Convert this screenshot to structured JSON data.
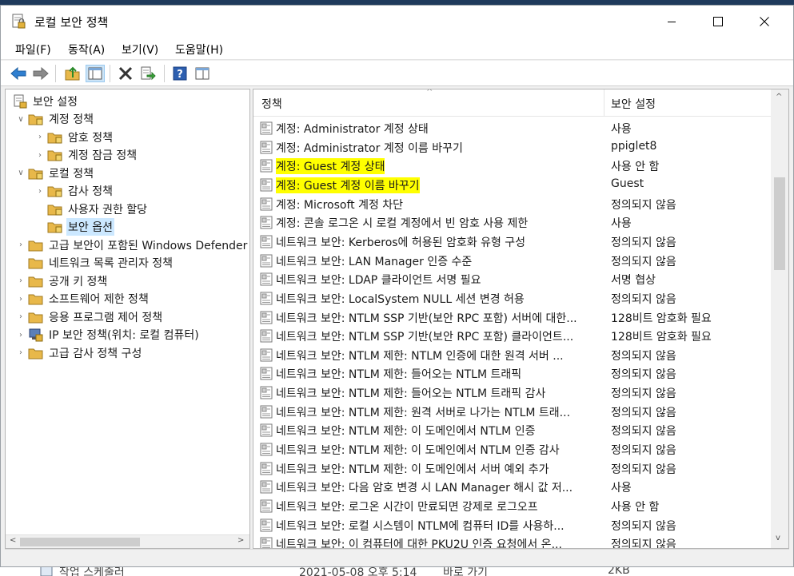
{
  "window": {
    "title": "로컬 보안 정책"
  },
  "menu": [
    "파일(F)",
    "동작(A)",
    "보기(V)",
    "도움말(H)"
  ],
  "toolbar": [
    "back-icon",
    "forward-icon",
    "up-folder-icon",
    "show-hide-tree-icon",
    "delete-icon",
    "export-list-icon",
    "help-icon",
    "properties-icon"
  ],
  "tree": {
    "root": "보안 설정",
    "nodes": [
      {
        "label": "계정 정책",
        "level": 1,
        "expander": "expanded"
      },
      {
        "label": "암호 정책",
        "level": 2,
        "expander": "collapsed"
      },
      {
        "label": "계정 잠금 정책",
        "level": 2,
        "expander": "collapsed"
      },
      {
        "label": "로컬 정책",
        "level": 1,
        "expander": "expanded"
      },
      {
        "label": "감사 정책",
        "level": 2,
        "expander": "collapsed"
      },
      {
        "label": "사용자 권한 할당",
        "level": 2,
        "expander": "none"
      },
      {
        "label": "보안 옵션",
        "level": 2,
        "expander": "none",
        "selected": true
      },
      {
        "label": "고급 보안이 포함된 Windows Defender 방화벽",
        "level": 1,
        "expander": "collapsed"
      },
      {
        "label": "네트워크 목록 관리자 정책",
        "level": 1,
        "expander": "none"
      },
      {
        "label": "공개 키 정책",
        "level": 1,
        "expander": "collapsed"
      },
      {
        "label": "소프트웨어 제한 정책",
        "level": 1,
        "expander": "collapsed"
      },
      {
        "label": "응용 프로그램 제어 정책",
        "level": 1,
        "expander": "collapsed"
      },
      {
        "label": "IP 보안 정책(위치: 로컬 컴퓨터)",
        "level": 1,
        "expander": "collapsed",
        "icon": "ip-security-icon"
      },
      {
        "label": "고급 감사 정책 구성",
        "level": 1,
        "expander": "collapsed"
      }
    ]
  },
  "list": {
    "columns": {
      "policy": "정책",
      "setting": "보안 설정"
    },
    "rows": [
      {
        "policy": "계정: Administrator 계정 상태",
        "setting": "사용"
      },
      {
        "policy": "계정: Administrator 계정 이름 바꾸기",
        "setting": "ppiglet8"
      },
      {
        "policy": "계정: Guest 계정 상태",
        "setting": "사용 안 함",
        "highlighted": true
      },
      {
        "policy": "계정: Guest 계정 이름 바꾸기",
        "setting": "Guest",
        "highlighted": true
      },
      {
        "policy": "계정: Microsoft 계정 차단",
        "setting": "정의되지 않음"
      },
      {
        "policy": "계정: 콘솔 로그온 시 로컬 계정에서 빈 암호 사용 제한",
        "setting": "사용"
      },
      {
        "policy": "네트워크 보안: Kerberos에 허용된 암호화 유형 구성",
        "setting": "정의되지 않음"
      },
      {
        "policy": "네트워크 보안: LAN Manager 인증 수준",
        "setting": "정의되지 않음"
      },
      {
        "policy": "네트워크 보안: LDAP 클라이언트 서명 필요",
        "setting": "서명 협상"
      },
      {
        "policy": "네트워크 보안: LocalSystem NULL 세션 변경 허용",
        "setting": "정의되지 않음"
      },
      {
        "policy": "네트워크 보안: NTLM SSP 기반(보안 RPC 포함) 서버에 대한...",
        "setting": "128비트 암호화 필요"
      },
      {
        "policy": "네트워크 보안: NTLM SSP 기반(보안 RPC 포함) 클라이언트...",
        "setting": "128비트 암호화 필요"
      },
      {
        "policy": "네트워크 보안: NTLM 제한: NTLM 인증에 대한 원격 서버 ...",
        "setting": "정의되지 않음"
      },
      {
        "policy": "네트워크 보안: NTLM 제한: 들어오는 NTLM 트래픽",
        "setting": "정의되지 않음"
      },
      {
        "policy": "네트워크 보안: NTLM 제한: 들어오는 NTLM 트래픽 감사",
        "setting": "정의되지 않음"
      },
      {
        "policy": "네트워크 보안: NTLM 제한: 원격 서버로 나가는 NTLM 트래...",
        "setting": "정의되지 않음"
      },
      {
        "policy": "네트워크 보안: NTLM 제한: 이 도메인에서 NTLM 인증",
        "setting": "정의되지 않음"
      },
      {
        "policy": "네트워크 보안: NTLM 제한: 이 도메인에서 NTLM 인증 감사",
        "setting": "정의되지 않음"
      },
      {
        "policy": "네트워크 보안: NTLM 제한: 이 도메인에서 서버 예외 추가",
        "setting": "정의되지 않음"
      },
      {
        "policy": "네트워크 보안: 다음 암호 변경 시 LAN Manager 해시 값 저...",
        "setting": "사용"
      },
      {
        "policy": "네트워크 보안: 로그온 시간이 만료되면 강제로 로그오프",
        "setting": "사용 안 함"
      },
      {
        "policy": "네트워크 보안: 로컬 시스템이 NTLM에 컴퓨터 ID를 사용하...",
        "setting": "정의되지 않음"
      },
      {
        "policy": "네트워크 보안: 이 컴퓨터에 대한 PKU2U 인증 요청에서 온...",
        "setting": "정의되지 않음"
      }
    ]
  },
  "background_window": {
    "name": "작업 스케줄러",
    "date": "2021-05-08 오후 5:14",
    "type": "바로 가기",
    "size": "2KB"
  },
  "colors": {
    "highlight": "#ffff00",
    "selection": "#cce8ff",
    "folder": "#e8b84a"
  }
}
